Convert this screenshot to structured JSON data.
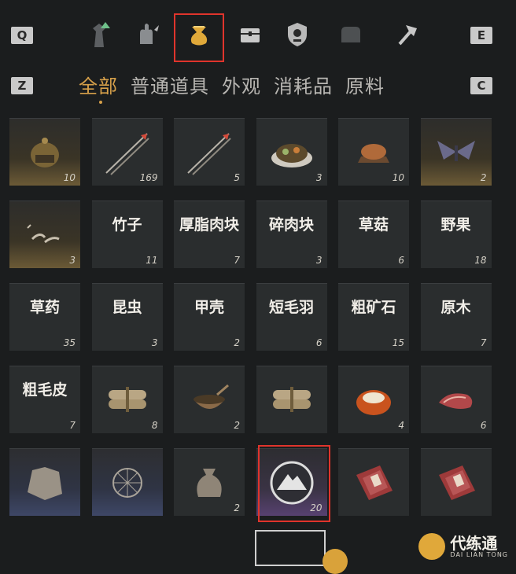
{
  "keys": {
    "q": "Q",
    "e": "E",
    "z": "Z",
    "c": "C"
  },
  "categories": [
    {
      "icon": "tower-icon"
    },
    {
      "icon": "hand-icon"
    },
    {
      "icon": "pouch-icon",
      "selected": true
    },
    {
      "icon": "chest-icon"
    },
    {
      "icon": "shield-icon"
    },
    {
      "icon": "bag-icon"
    },
    {
      "icon": "hammer-icon"
    }
  ],
  "tabs": [
    {
      "label": "全部",
      "active": true
    },
    {
      "label": "普通道具"
    },
    {
      "label": "外观"
    },
    {
      "label": "消耗品"
    },
    {
      "label": "原料"
    }
  ],
  "items": [
    {
      "name": "",
      "icon": "helmet-icon",
      "qty": "10",
      "tone": "gold"
    },
    {
      "name": "",
      "icon": "arrow-icon",
      "qty": "169",
      "tone": ""
    },
    {
      "name": "",
      "icon": "arrow-icon",
      "qty": "5",
      "tone": ""
    },
    {
      "name": "",
      "icon": "food-plate-icon",
      "qty": "3",
      "tone": ""
    },
    {
      "name": "",
      "icon": "roast-meat-icon",
      "qty": "10",
      "tone": ""
    },
    {
      "name": "",
      "icon": "moth-icon",
      "qty": "2",
      "tone": "gold"
    },
    {
      "name": "",
      "icon": "feathers-icon",
      "qty": "3",
      "tone": "gold"
    },
    {
      "name": "竹子",
      "icon": "",
      "qty": "11",
      "tone": ""
    },
    {
      "name": "厚脂肉块",
      "icon": "",
      "qty": "7",
      "tone": ""
    },
    {
      "name": "碎肉块",
      "icon": "",
      "qty": "3",
      "tone": ""
    },
    {
      "name": "草菇",
      "icon": "",
      "qty": "6",
      "tone": ""
    },
    {
      "name": "野果",
      "icon": "",
      "qty": "18",
      "tone": ""
    },
    {
      "name": "草药",
      "icon": "",
      "qty": "35",
      "tone": ""
    },
    {
      "name": "昆虫",
      "icon": "",
      "qty": "3",
      "tone": ""
    },
    {
      "name": "甲壳",
      "icon": "",
      "qty": "2",
      "tone": ""
    },
    {
      "name": "短毛羽",
      "icon": "",
      "qty": "6",
      "tone": ""
    },
    {
      "name": "粗矿石",
      "icon": "",
      "qty": "15",
      "tone": ""
    },
    {
      "name": "原木",
      "icon": "",
      "qty": "7",
      "tone": ""
    },
    {
      "name": "粗毛皮",
      "icon": "",
      "qty": "7",
      "tone": ""
    },
    {
      "name": "",
      "icon": "bundle-icon",
      "qty": "8",
      "tone": ""
    },
    {
      "name": "",
      "icon": "bowl-icon",
      "qty": "2",
      "tone": ""
    },
    {
      "name": "",
      "icon": "bundle-icon",
      "qty": "",
      "tone": ""
    },
    {
      "name": "",
      "icon": "bread-icon",
      "qty": "4",
      "tone": ""
    },
    {
      "name": "",
      "icon": "steak-icon",
      "qty": "6",
      "tone": ""
    },
    {
      "name": "",
      "icon": "fur-icon",
      "qty": "",
      "tone": "blue"
    },
    {
      "name": "",
      "icon": "net-icon",
      "qty": "",
      "tone": "blue"
    },
    {
      "name": "",
      "icon": "sack-icon",
      "qty": "2",
      "tone": ""
    },
    {
      "name": "",
      "icon": "mountain-token-icon",
      "qty": "20",
      "tone": "purple"
    },
    {
      "name": "",
      "icon": "red-box-icon",
      "qty": "",
      "tone": ""
    },
    {
      "name": "",
      "icon": "red-box-icon",
      "qty": "",
      "tone": ""
    }
  ],
  "watermark": {
    "main": "代练通",
    "sub": "DAI LIAN TONG"
  }
}
